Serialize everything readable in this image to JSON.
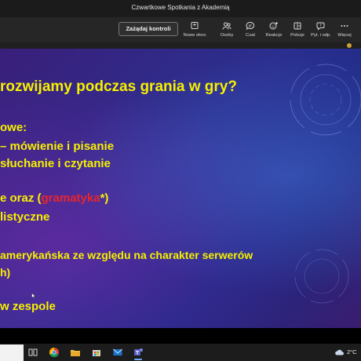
{
  "window": {
    "title": "Czwartkowe Spotkania z Akademią"
  },
  "toolbar": {
    "control_button": "Zażądaj kontroli",
    "items": [
      {
        "label": "Nowe okno",
        "icon": "new-window-icon"
      },
      {
        "label": "Osoby",
        "icon": "people-icon"
      },
      {
        "label": "Czat",
        "icon": "chat-icon"
      },
      {
        "label": "Reakcje",
        "icon": "reactions-icon"
      },
      {
        "label": "Pokoje",
        "icon": "rooms-icon"
      },
      {
        "label": "Pyt. i odp.",
        "icon": "qa-icon"
      },
      {
        "label": "Więcej",
        "icon": "more-icon"
      }
    ]
  },
  "slide": {
    "title": "rozwijamy podczas grania w gry?",
    "lines": [
      "owe:",
      "– mówienie i pisanie",
      "słuchanie i czytanie",
      "listyczne",
      "amerykańska ze względu na charakter serwerów",
      "h)",
      "w zespole"
    ],
    "line4_pre": "e oraz (",
    "line4_highlight": "gramatyka",
    "line4_post": "*)",
    "highlight_color": "#e8252c",
    "text_color": "#f6f000"
  },
  "taskbar": {
    "apps": [
      "task-view-icon",
      "chrome-icon",
      "file-explorer-icon",
      "store-icon",
      "mail-icon",
      "teams-icon"
    ],
    "weather": {
      "temp": "2°C",
      "icon": "cloud-icon"
    }
  }
}
